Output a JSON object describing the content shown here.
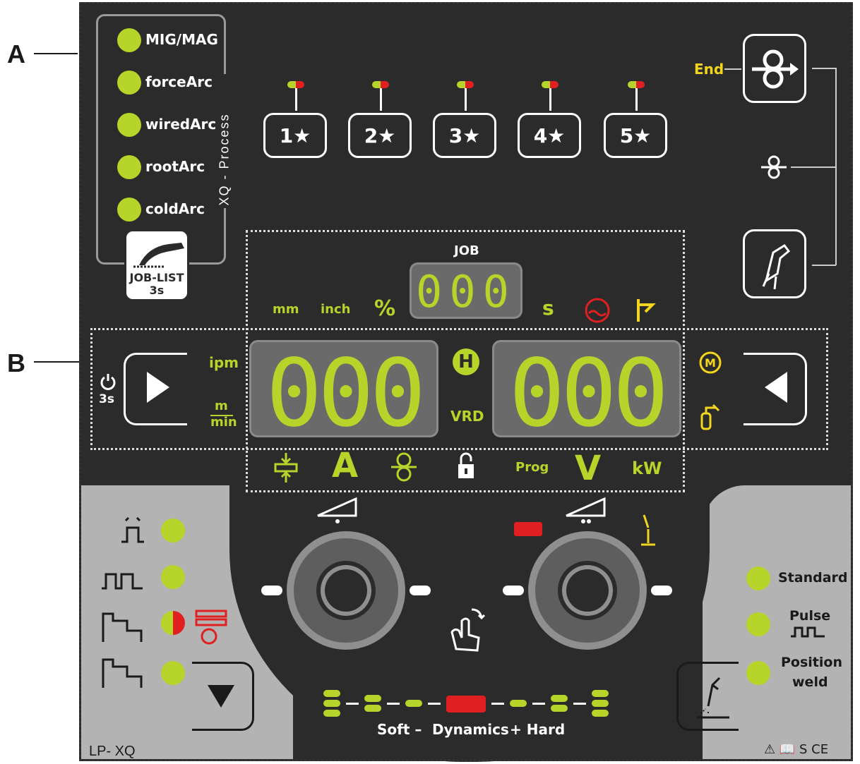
{
  "callouts": {
    "a": "A",
    "b": "B"
  },
  "process": {
    "title": "XQ - Process",
    "items": [
      {
        "label": "MIG/MAG"
      },
      {
        "label": "forceArc"
      },
      {
        "label": "wiredArc"
      },
      {
        "label": "rootArc"
      },
      {
        "label": "coldArc"
      }
    ],
    "job_list_line1": "JOB-LIST",
    "job_list_line2": "3s"
  },
  "favourites": [
    {
      "label": "1★"
    },
    {
      "label": "2★"
    },
    {
      "label": "3★"
    },
    {
      "label": "4★"
    },
    {
      "label": "5★"
    }
  ],
  "right_column": {
    "end_label": "End"
  },
  "job_display": {
    "title": "JOB",
    "value": "000"
  },
  "unit_labels": {
    "mm": "mm",
    "inch": "inch",
    "percent": "%",
    "seconds": "s"
  },
  "left_display": {
    "value": "000",
    "power_label": "3s",
    "unit_ipm": "ipm",
    "unit_m": "m",
    "unit_min": "min"
  },
  "center_labels": {
    "hold": "H",
    "vrd": "VRD"
  },
  "right_display": {
    "value": "000"
  },
  "bottom_row": {
    "amps": "A",
    "prog": "Prog",
    "volts": "V",
    "kw": "kW"
  },
  "weld_types": [
    {
      "label": "Standard"
    },
    {
      "label": "Pulse"
    },
    {
      "label": "Position weld"
    }
  ],
  "weld_type_position_line1": "Position",
  "weld_type_position_line2": "weld",
  "dynamics": {
    "soft": "Soft –",
    "label": "Dynamics",
    "hard": "+ Hard"
  },
  "model": {
    "name": "LP- XQ",
    "marks": "⚠ 📖 S CE"
  },
  "colors": {
    "accent_green": "#b7d42a",
    "red": "#e02020",
    "yellow": "#f2d51c",
    "panel": "#2b2b2b",
    "gray": "#b3b3b3"
  }
}
